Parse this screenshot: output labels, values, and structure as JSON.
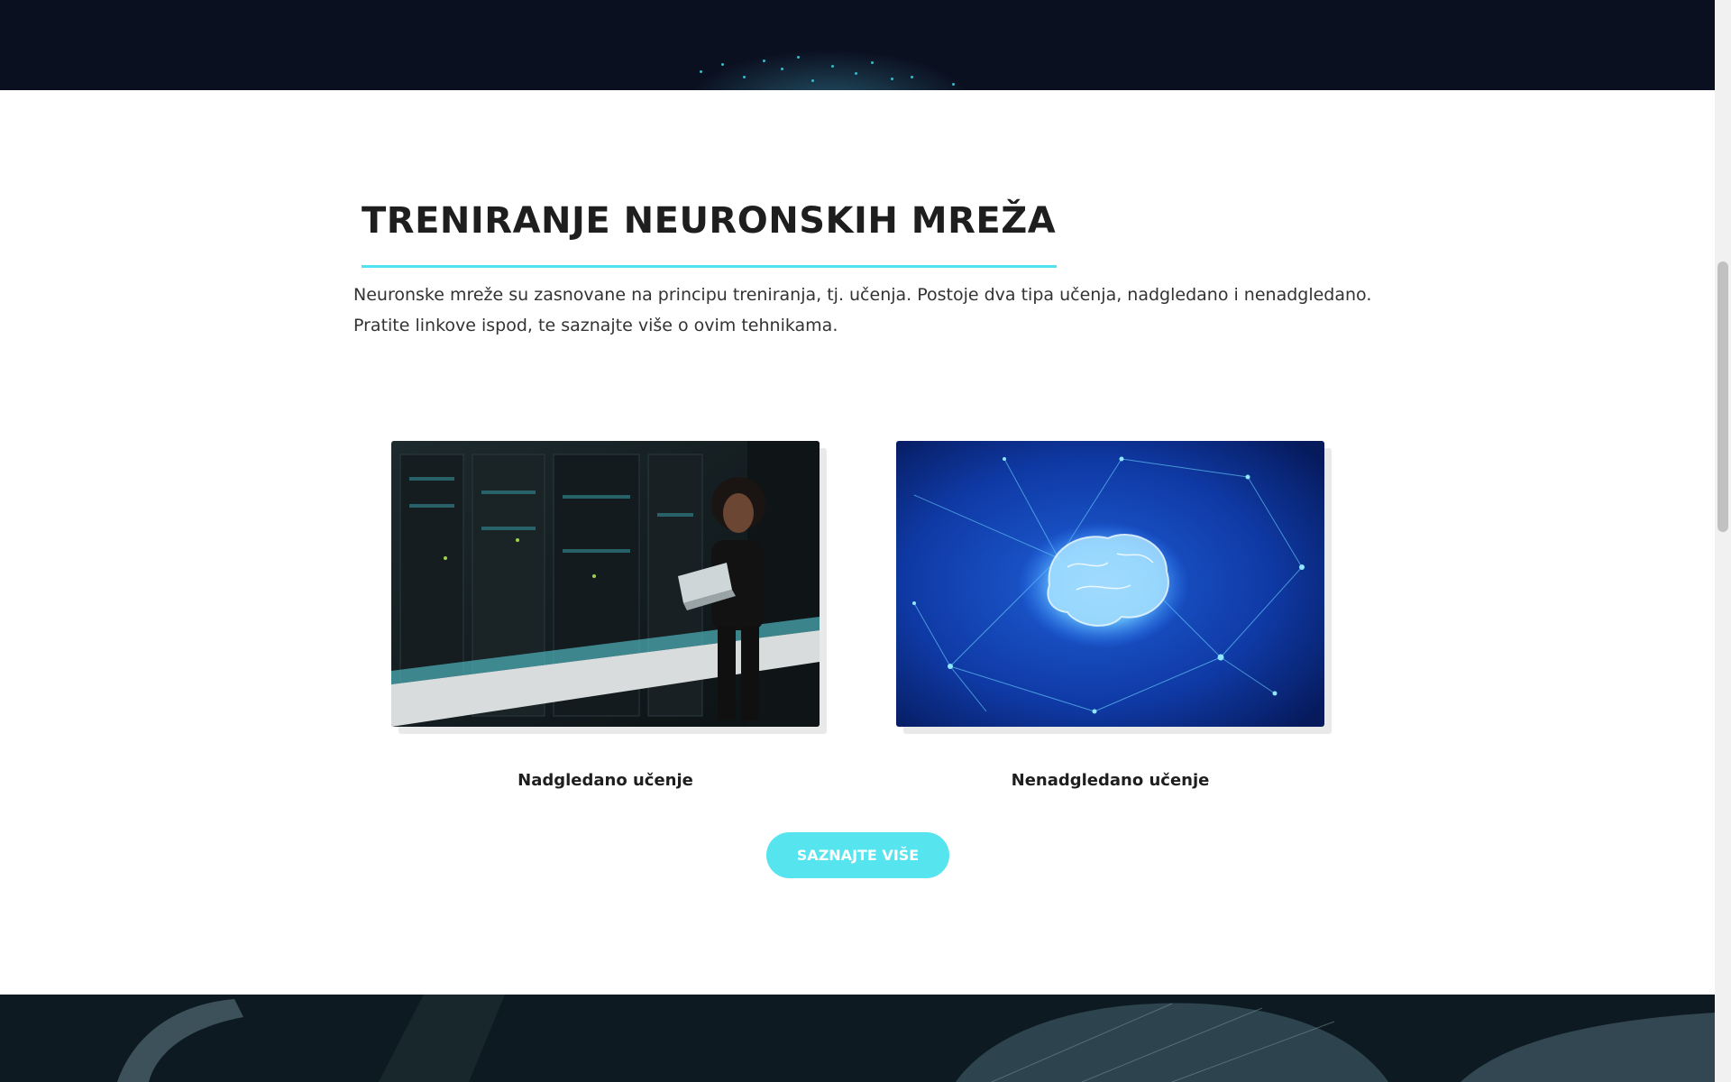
{
  "section": {
    "title": "TRENIRANJE NEURONSKIH MREŽA",
    "intro": "Neuronske mreže su zasnovane na principu treniranja, tj. učenja. Postoje dva tipa učenja, nadgledano i nenadgledano. Pratite linkove ispod, te saznajte više o ovim tehnikama.",
    "accent_color": "#4ee3ee"
  },
  "cards": [
    {
      "label": "Nadgledano učenje",
      "image": "woman-with-laptop-in-server-room-photo"
    },
    {
      "label": "Nenadgledano učenje",
      "image": "glowing-brain-network-photo"
    }
  ],
  "cta": {
    "label": "SAZNAJTE VIŠE",
    "color": "#56e4ee"
  },
  "banners": {
    "top_color": "#0b1020",
    "bottom_color": "#0e1a22"
  }
}
